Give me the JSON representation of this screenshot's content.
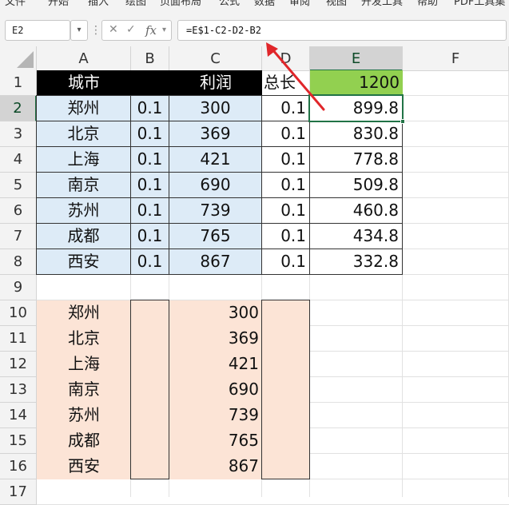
{
  "ribbon": {
    "tabs": [
      "文件",
      "开始",
      "插入",
      "绘图",
      "页面布局",
      "公式",
      "数据",
      "审阅",
      "视图",
      "开发工具",
      "帮助",
      "PDF工具集"
    ]
  },
  "formula_bar": {
    "name_box": "E2",
    "formula": "=E$1-C2-D2-B2"
  },
  "columns": [
    "A",
    "B",
    "C",
    "D",
    "E",
    "F"
  ],
  "rows": [
    "1",
    "2",
    "3",
    "4",
    "5",
    "6",
    "7",
    "8",
    "9",
    "10",
    "11",
    "12",
    "13",
    "14",
    "15",
    "16",
    "17"
  ],
  "sheet": {
    "header": {
      "a": "城市",
      "c": "利润",
      "d": "总长",
      "e": "1200"
    },
    "upper": [
      {
        "city": "郑州",
        "b": "0.1",
        "profit": "300",
        "d": "0.1",
        "e": "899.8"
      },
      {
        "city": "北京",
        "b": "0.1",
        "profit": "369",
        "d": "0.1",
        "e": "830.8"
      },
      {
        "city": "上海",
        "b": "0.1",
        "profit": "421",
        "d": "0.1",
        "e": "778.8"
      },
      {
        "city": "南京",
        "b": "0.1",
        "profit": "690",
        "d": "0.1",
        "e": "509.8"
      },
      {
        "city": "苏州",
        "b": "0.1",
        "profit": "739",
        "d": "0.1",
        "e": "460.8"
      },
      {
        "city": "成都",
        "b": "0.1",
        "profit": "765",
        "d": "0.1",
        "e": "434.8"
      },
      {
        "city": "西安",
        "b": "0.1",
        "profit": "867",
        "d": "0.1",
        "e": "332.8"
      }
    ],
    "lower": [
      {
        "city": "郑州",
        "profit": "300"
      },
      {
        "city": "北京",
        "profit": "369"
      },
      {
        "city": "上海",
        "profit": "421"
      },
      {
        "city": "南京",
        "profit": "690"
      },
      {
        "city": "苏州",
        "profit": "739"
      },
      {
        "city": "成都",
        "profit": "765"
      },
      {
        "city": "西安",
        "profit": "867"
      }
    ]
  },
  "colors": {
    "header_fill": "#000000",
    "header_text": "#ffffff",
    "total_fill": "#92d050",
    "upper_fill": "#ddebf7",
    "lower_fill": "#fce4d6",
    "selection": "#217346",
    "arrow": "#e0262a"
  }
}
